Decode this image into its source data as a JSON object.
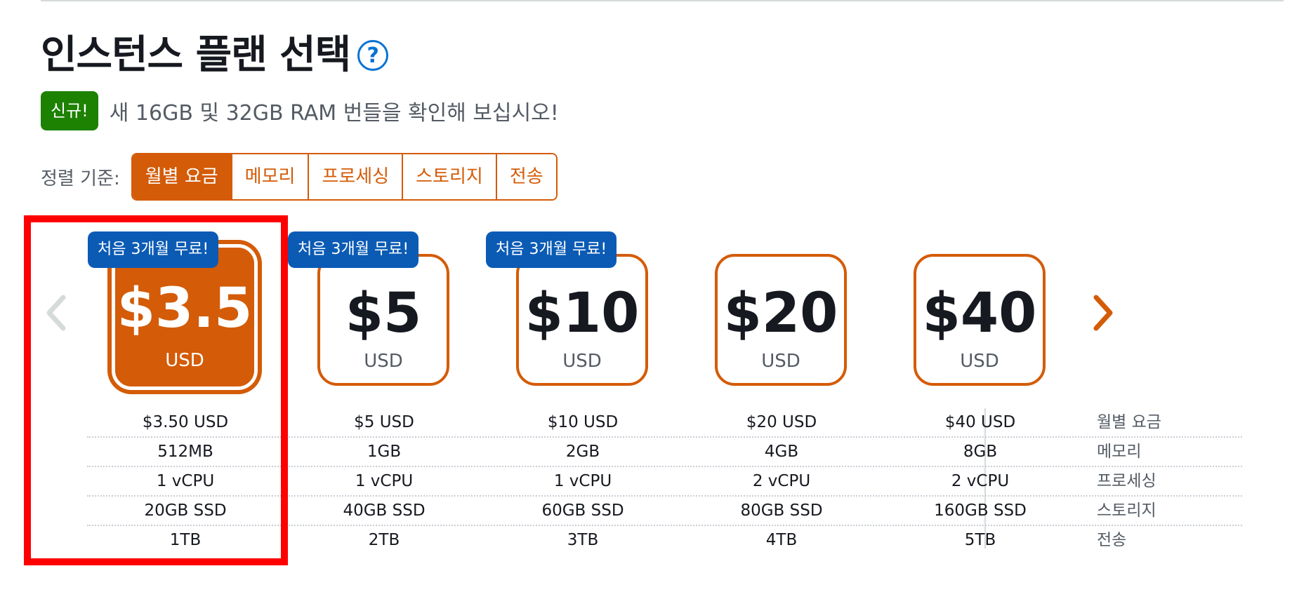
{
  "header": {
    "title": "인스턴스 플랜 선택",
    "help_icon": "?"
  },
  "announcement": {
    "badge": "신규!",
    "text": "새 16GB 및 32GB RAM 번들을 확인해 보십시오!"
  },
  "sort": {
    "label": "정렬 기준:",
    "options": [
      "월별 요금",
      "메모리",
      "프로세싱",
      "스토리지",
      "전송"
    ],
    "active": "월별 요금"
  },
  "plans": [
    {
      "price": "$3.5",
      "currency": "USD",
      "badge": "처음 3개월 무료!",
      "selected": true
    },
    {
      "price": "$5",
      "currency": "USD",
      "badge": "처음 3개월 무료!",
      "selected": false
    },
    {
      "price": "$10",
      "currency": "USD",
      "badge": "처음 3개월 무료!",
      "selected": false
    },
    {
      "price": "$20",
      "currency": "USD",
      "badge": "",
      "selected": false
    },
    {
      "price": "$40",
      "currency": "USD",
      "badge": "",
      "selected": false
    }
  ],
  "specs": {
    "rows": [
      {
        "label": "월별 요금",
        "values": [
          "$3.50 USD",
          "$5 USD",
          "$10 USD",
          "$20 USD",
          "$40 USD"
        ]
      },
      {
        "label": "메모리",
        "values": [
          "512MB",
          "1GB",
          "2GB",
          "4GB",
          "8GB"
        ]
      },
      {
        "label": "프로세싱",
        "values": [
          "1 vCPU",
          "1 vCPU",
          "1 vCPU",
          "2 vCPU",
          "2 vCPU"
        ]
      },
      {
        "label": "스토리지",
        "values": [
          "20GB SSD",
          "40GB SSD",
          "60GB SSD",
          "80GB SSD",
          "160GB SSD"
        ]
      },
      {
        "label": "전송",
        "values": [
          "1TB",
          "2TB",
          "3TB",
          "4TB",
          "5TB"
        ]
      }
    ]
  },
  "colors": {
    "accent": "#d45b07",
    "badge_blue": "#0b5bb5",
    "new_green": "#1d8102",
    "highlight_red": "#ff0000"
  },
  "icons": {
    "prev": "chevron-left-icon",
    "next": "chevron-right-icon"
  }
}
